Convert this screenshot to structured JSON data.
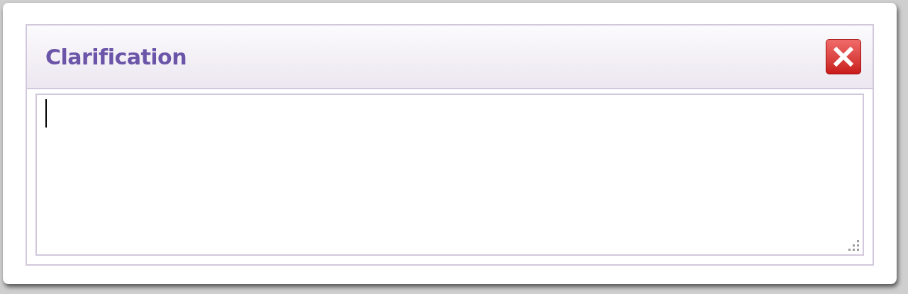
{
  "dialog": {
    "title": "Clarification"
  }
}
